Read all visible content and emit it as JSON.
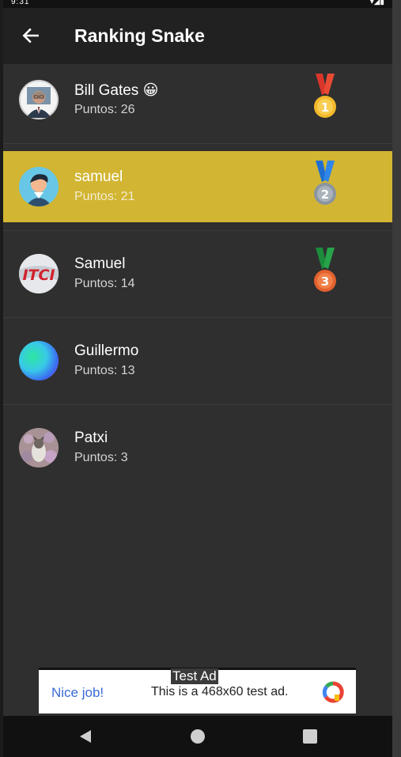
{
  "status_bar": {
    "time": "9:31",
    "icons": "▾◢▮"
  },
  "app_bar": {
    "title": "Ranking Snake"
  },
  "points_prefix": "Puntos: ",
  "colors": {
    "highlight": "#d2b532",
    "background": "#2f2f2f",
    "appbar": "#212121",
    "gold": "#f2b92a",
    "silver": "#9aa3ad",
    "bronze": "#e8763a"
  },
  "players": [
    {
      "name": "Bill Gates 😀",
      "points": "Puntos: 26",
      "medal": "gold-medal-icon",
      "medal_number": "1",
      "avatar": "bill-gates-photo",
      "highlighted": false
    },
    {
      "name": "samuel",
      "points": "Puntos: 21",
      "medal": "silver-medal-icon",
      "medal_number": "2",
      "avatar": "cartoon-man-avatar",
      "highlighted": true
    },
    {
      "name": "Samuel",
      "points": "Puntos: 14",
      "medal": "bronze-medal-icon",
      "medal_number": "3",
      "avatar": "logo-avatar",
      "highlighted": false
    },
    {
      "name": "Guillermo",
      "points": "Puntos: 13",
      "medal": "",
      "medal_number": "",
      "avatar": "gradient-avatar",
      "highlighted": false
    },
    {
      "name": "Patxi",
      "points": "Puntos: 3",
      "medal": "",
      "medal_number": "",
      "avatar": "dog-photo-avatar",
      "highlighted": false
    }
  ],
  "ad": {
    "label": "Test Ad",
    "cta": "Nice job!",
    "text": "This is a 468x60 test ad."
  },
  "nav": {
    "back": "back-triangle-icon",
    "home": "home-circle-icon",
    "recents": "recents-square-icon"
  }
}
